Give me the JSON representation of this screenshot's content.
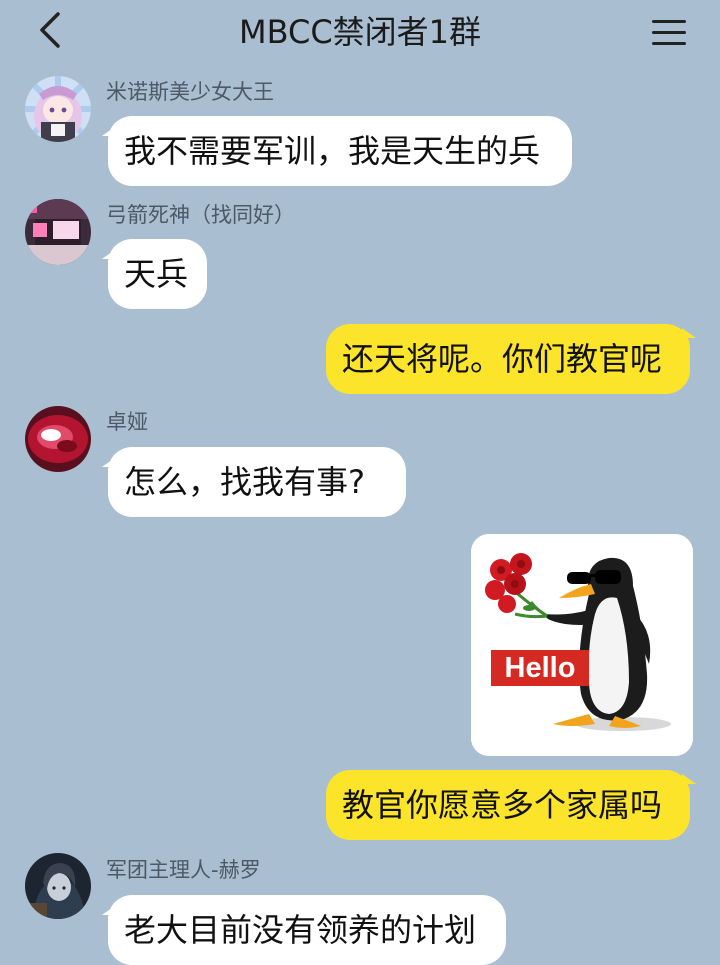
{
  "header": {
    "title": "MBCC禁闭者1群",
    "back_icon": "chevron-left-icon",
    "menu_icon": "hamburger-menu-icon"
  },
  "messages": [
    {
      "sender": "米诺斯美少女大王",
      "text": "我不需要军训，我是天生的兵",
      "direction": "incoming"
    },
    {
      "sender": "弓箭死神（找同好）",
      "text": "天兵",
      "direction": "incoming"
    },
    {
      "text": "还天将呢。你们教官呢",
      "direction": "outgoing"
    },
    {
      "sender": "卓娅",
      "text": "怎么，找我有事?",
      "direction": "incoming"
    },
    {
      "direction": "outgoing",
      "sticker_text": "Hello",
      "sticker": "penguin-with-roses-sticker"
    },
    {
      "text": "教官你愿意多个家属吗",
      "direction": "outgoing"
    },
    {
      "sender": "军团主理人-赫罗",
      "text": "老大目前没有领养的计划",
      "direction": "incoming"
    }
  ],
  "colors": {
    "background": "#a9bed1",
    "incoming_bubble": "#ffffff",
    "outgoing_bubble": "#fbe42a",
    "sticker_sign": "#d52a22"
  }
}
